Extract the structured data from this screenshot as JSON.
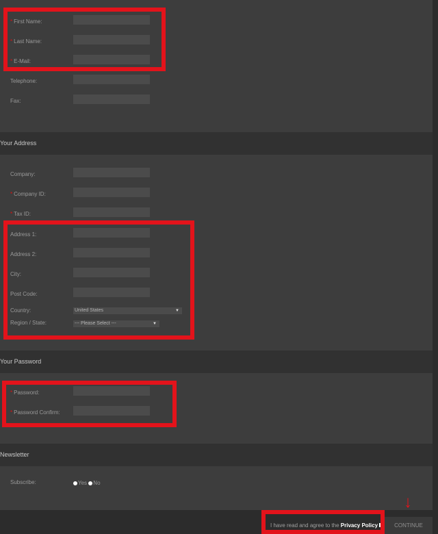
{
  "personal": {
    "first_name": "First Name:",
    "last_name": "Last Name:",
    "email": "E-Mail:",
    "telephone": "Telephone:",
    "fax": "Fax:"
  },
  "address": {
    "heading": "Your Address",
    "company": "Company:",
    "company_id": "Company ID:",
    "tax_id": "Tax ID:",
    "address1": "Address 1:",
    "address2": "Address 2:",
    "city": "City:",
    "post_code": "Post Code:",
    "country_label": "Country:",
    "country_value": "United States",
    "region_label": "Region / State:",
    "region_value": "--- Please Select ---"
  },
  "password": {
    "heading": "Your Password",
    "password": "Password:",
    "confirm": "Password Confirm:"
  },
  "newsletter": {
    "heading": "Newsletter",
    "subscribe": "Subscribe:",
    "yes": "Yes",
    "no": "No"
  },
  "footer": {
    "agree_text": "I have read and agree to the",
    "privacy_link": "Privacy Policy",
    "continue_label": "CONTINUE"
  },
  "required_mark": "*",
  "annotation_arrow": "↓",
  "colors": {
    "highlight": "#e3131b",
    "panel": "#3d3d3d",
    "header": "#313131"
  }
}
